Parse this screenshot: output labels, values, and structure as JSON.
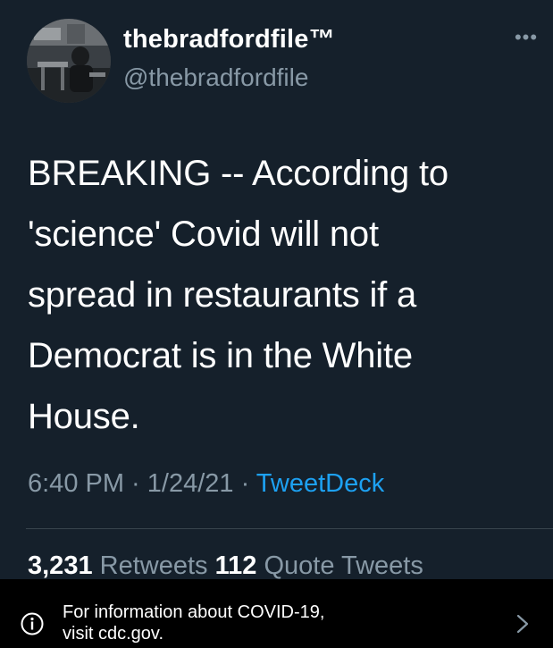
{
  "tweet": {
    "display_name": "thebradfordfile™",
    "handle": "@thebradfordfile",
    "text": "BREAKING -- According to\n'science' Covid will not\nspread in restaurants if a\nDemocrat is in the White\nHouse.",
    "time": "6:40 PM",
    "separator": " · ",
    "date": "1/24/21",
    "source": "TweetDeck",
    "retweets_count": "3,231",
    "retweets_label": "Retweets",
    "quote_count": "112",
    "quote_label": "Quote Tweets",
    "more_glyph": "•••"
  },
  "banner": {
    "text": "For information about COVID-19,\nvisit cdc.gov."
  },
  "icons": {
    "avatar": "profile-photo",
    "more": "more-options-icon",
    "info": "info-icon",
    "chevron": "chevron-right-icon"
  },
  "colors": {
    "background": "#15202b",
    "secondary_text": "#8899a6",
    "link": "#1da1f2",
    "banner_background": "#000000"
  }
}
